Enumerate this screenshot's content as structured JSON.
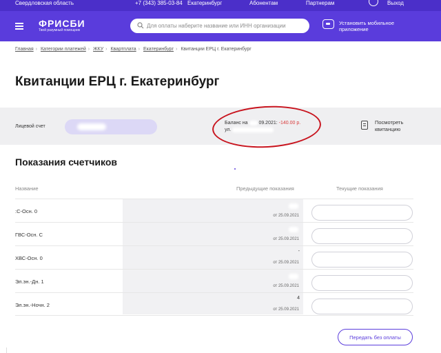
{
  "topbar": {
    "region": "Свердловская область",
    "phone": "+7 (343) 385-03-84",
    "city": "Екатеринбург",
    "subscribers": "Абонентам",
    "partners": "Партнерам",
    "exit": "Выход"
  },
  "header": {
    "logo_title": "ФРИСБИ",
    "logo_subtitle": "Твой разумный помощник",
    "search_placeholder": "Для оплаты наберите название или ИНН организации",
    "app_promo": "Установить мобильное приложение"
  },
  "breadcrumb": {
    "items": [
      "Главная",
      "Категории платежей",
      "ЖКУ",
      "Квартплата",
      "Екатеринбург"
    ],
    "current": "Квитанции ЕРЦ г. Екатеринбург"
  },
  "page_title": "Квитанции ЕРЦ г. Екатеринбург",
  "account": {
    "label": "Лицевой счет",
    "balance_prefix": "Баланс на",
    "balance_date": "09.2021:",
    "balance_amount": "-140.00 р.",
    "address_prefix": "ул.",
    "receipt_label": "Посмотреть квитанцию"
  },
  "meters": {
    "title": "Показания счетчиков",
    "columns": {
      "name": "Название",
      "previous": "Предыдущие показания",
      "current": "Текущие показания"
    },
    "rows": [
      {
        "name": ":С-Осн. 0",
        "prev_value": "",
        "prev_date": "от 25.09.2021"
      },
      {
        "name": "ГВС-Осн. С",
        "prev_value": "",
        "prev_date": "от 25.09.2021"
      },
      {
        "name": "ХВС-Осн. 0",
        "prev_value": "-",
        "prev_date": "от 25.09.2021"
      },
      {
        "name": "Эл.эн.-Дн. 1",
        "prev_value": "",
        "prev_date": "от 25.09.2021"
      },
      {
        "name": "Эл.эн.-Ночн. 2",
        "prev_value": "4",
        "prev_date": "от 25.09.2021"
      }
    ],
    "submit_label": "Передать без оплаты"
  }
}
